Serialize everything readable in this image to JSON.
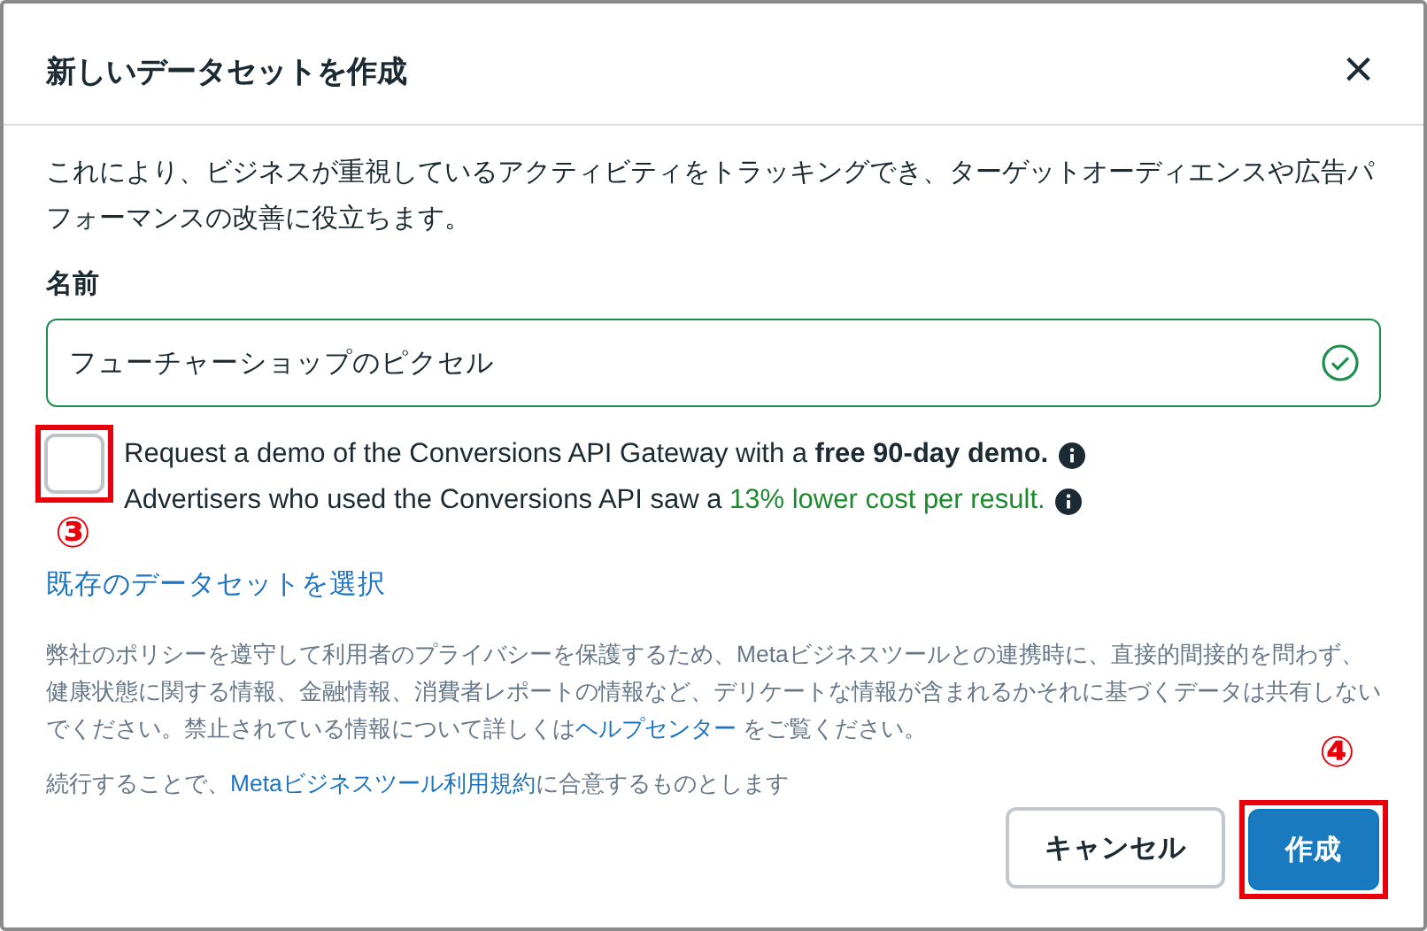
{
  "dialog": {
    "title": "新しいデータセットを作成",
    "close": "×",
    "description": "これにより、ビジネスが重視しているアクティビティをトラッキングでき、ターゲットオーディエンスや広告パフォーマンスの改善に役立ちます。"
  },
  "name_field": {
    "label": "名前",
    "value": "フューチャーショップのピクセル",
    "valid": true
  },
  "demo_checkbox": {
    "checked": false,
    "line_1": "Request a demo of the Conversions API Gateway with a **free 90-day demo.**",
    "line_2": {
      "text": "Advertisers who used the Conversions API saw a ",
      "highlight": "13% lower cost per result."
    }
  },
  "existing_link": "既存のデータセットを選択",
  "policy": {
    "before": "弊社のポリシーを遵守して利用者のプライバシーを保護するため、Metaビジネスツールとの連携時に、直接的間接的を問わず、健康状態に関する情報、金融情報、消費者レポートの情報など、デリケートな情報が含まれるかそれに基づくデータは共有しないでください。禁止されている情報について詳しくは",
    "link": "ヘルプセンター",
    "after": " をご覧ください。"
  },
  "terms": {
    "before": "続行することで、",
    "link": "Metaビジネスツール利用規約",
    "after": "に合意するものとします"
  },
  "buttons": [
    {
      "label": "キャンセル",
      "kind": "secondary"
    },
    {
      "label": "作成",
      "kind": "primary"
    }
  ],
  "annotations": [
    {
      "label": "③"
    },
    {
      "label": "④"
    }
  ]
}
